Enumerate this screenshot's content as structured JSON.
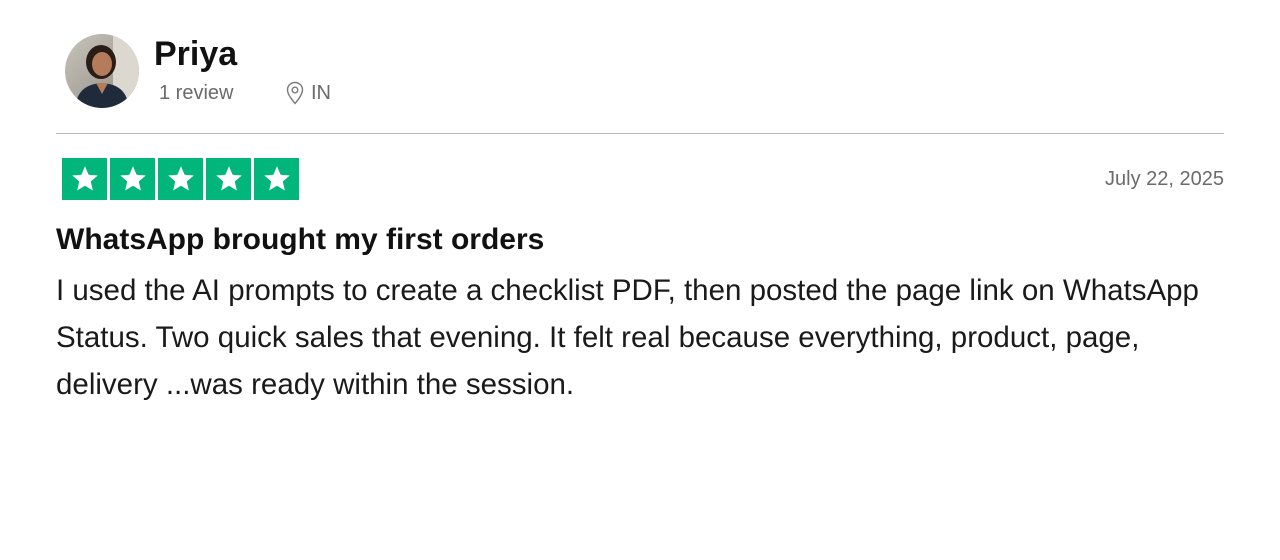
{
  "reviewer": {
    "name": "Priya",
    "review_count": "1 review",
    "location": "IN",
    "avatar_icon": "profile-photo",
    "location_icon": "map-pin-icon"
  },
  "review": {
    "rating": 5,
    "max_rating": 5,
    "star_color": "#00b67a",
    "date": "July 22, 2025",
    "title": "WhatsApp brought my first orders",
    "body": "I used the AI prompts to create a checklist PDF, then posted the page link on WhatsApp Status. Two quick sales that evening. It felt real because everything, product, page, delivery ...was ready within the session."
  }
}
